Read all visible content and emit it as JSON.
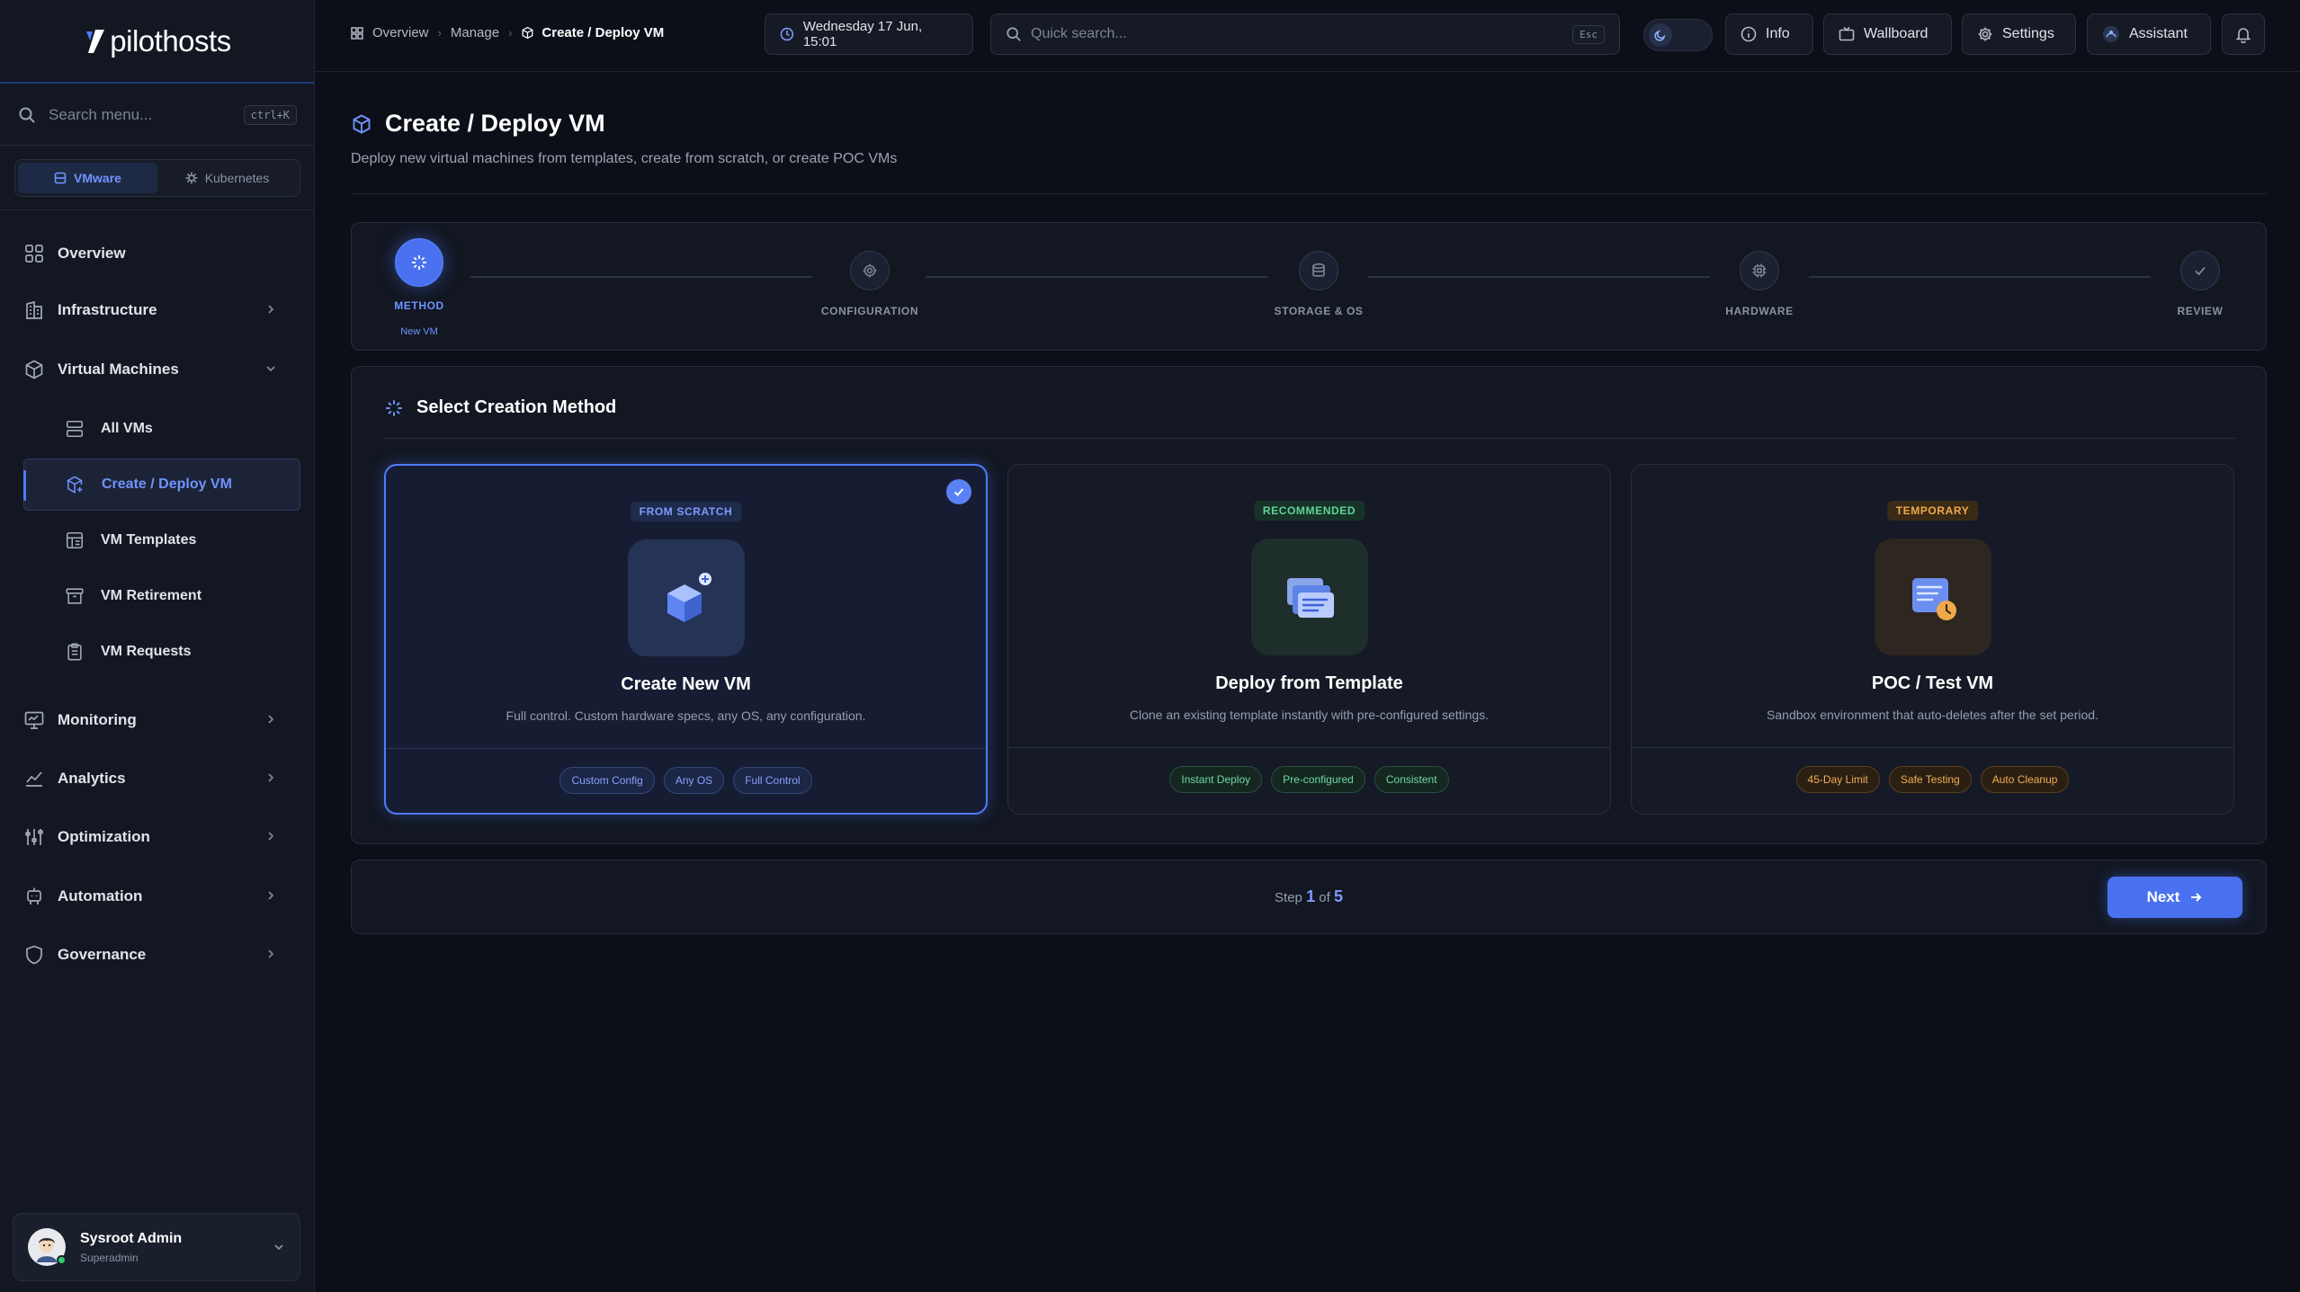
{
  "brand": {
    "name": "pilothosts"
  },
  "sidebar": {
    "search_placeholder": "Search menu...",
    "search_shortcut": "ctrl+K",
    "platform_tabs": [
      {
        "label": "VMware",
        "active": true
      },
      {
        "label": "Kubernetes",
        "active": false
      }
    ],
    "nav": {
      "overview": "Overview",
      "infrastructure": "Infrastructure",
      "virtual_machines": "Virtual Machines",
      "vm_children": {
        "all_vms": "All VMs",
        "create_deploy": "Create / Deploy VM",
        "templates": "VM Templates",
        "retirement": "VM Retirement",
        "requests": "VM Requests"
      },
      "monitoring": "Monitoring",
      "analytics": "Analytics",
      "optimization": "Optimization",
      "automation": "Automation",
      "governance": "Governance"
    },
    "user": {
      "name": "Sysroot Admin",
      "role": "Superadmin"
    }
  },
  "topbar": {
    "breadcrumbs": [
      "Overview",
      "Manage",
      "Create / Deploy VM"
    ],
    "datetime": "Wednesday 17 Jun, 15:01",
    "search_placeholder": "Quick search...",
    "search_shortcut": "Esc",
    "info": "Info",
    "wallboard": "Wallboard",
    "settings": "Settings",
    "assistant": "Assistant"
  },
  "page": {
    "title": "Create / Deploy VM",
    "subtitle": "Deploy new virtual machines from templates, create from scratch, or create POC VMs"
  },
  "stepper": {
    "steps": [
      {
        "label": "METHOD",
        "sublabel": "New VM",
        "active": true
      },
      {
        "label": "CONFIGURATION"
      },
      {
        "label": "STORAGE & OS"
      },
      {
        "label": "HARDWARE"
      },
      {
        "label": "REVIEW"
      }
    ]
  },
  "method": {
    "heading": "Select Creation Method",
    "cards": [
      {
        "badge": "FROM SCRATCH",
        "title": "Create New VM",
        "desc": "Full control. Custom hardware specs, any OS, any configuration.",
        "tags": [
          "Custom Config",
          "Any OS",
          "Full Control"
        ],
        "selected": true
      },
      {
        "badge": "RECOMMENDED",
        "title": "Deploy from Template",
        "desc": "Clone an existing template instantly with pre-configured settings.",
        "tags": [
          "Instant Deploy",
          "Pre-configured",
          "Consistent"
        ]
      },
      {
        "badge": "TEMPORARY",
        "title": "POC / Test VM",
        "desc": "Sandbox environment that auto-deletes after the set period.",
        "tags": [
          "45-Day Limit",
          "Safe Testing",
          "Auto Cleanup"
        ]
      }
    ]
  },
  "footer": {
    "step_prefix": "Step",
    "current_step": "1",
    "of_word": "of",
    "total_steps": "5",
    "next_label": "Next"
  },
  "colors": {
    "accent": "#4a72f0",
    "background": "#0c0f17",
    "success": "#5fd39a",
    "warning": "#f0a948"
  }
}
